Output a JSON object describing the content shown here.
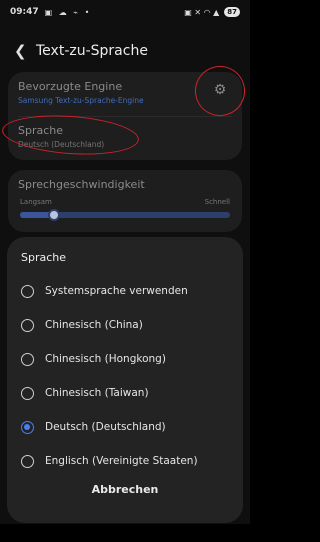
{
  "status_bar": {
    "time": "09:47",
    "status_icons": "▣ ☁ ⌁ •",
    "right_icons": "▣ ✕ ◠ ▲",
    "battery": "87"
  },
  "header": {
    "back_icon": "back-arrow-icon",
    "title": "Text-zu-Sprache"
  },
  "settings": {
    "engine_title": "Bevorzugte Engine",
    "engine_value": "Samsung Text-zu-Sprache-Engine",
    "language_title": "Sprache",
    "language_value": "Deutsch (Deutschland)",
    "speed_title": "Sprechgeschwindigkeit",
    "speed_min_label": "Langsam",
    "speed_max_label": "Schnell",
    "speed_level": 0.16
  },
  "dialog": {
    "title": "Sprache",
    "options": [
      {
        "label": "Systemsprache verwenden",
        "checked": false
      },
      {
        "label": "Chinesisch (China)",
        "checked": false
      },
      {
        "label": "Chinesisch (Hongkong)",
        "checked": false
      },
      {
        "label": "Chinesisch (Taiwan)",
        "checked": false
      },
      {
        "label": "Deutsch (Deutschland)",
        "checked": true
      },
      {
        "label": "Englisch (Vereinigte Staaten)",
        "checked": false
      }
    ],
    "cancel_label": "Abbrechen"
  },
  "colors": {
    "accent": "#4b7ff0",
    "link_blue": "#3f6dc2",
    "annotation_red": "#c8242b",
    "dialog_bg": "#232323"
  }
}
